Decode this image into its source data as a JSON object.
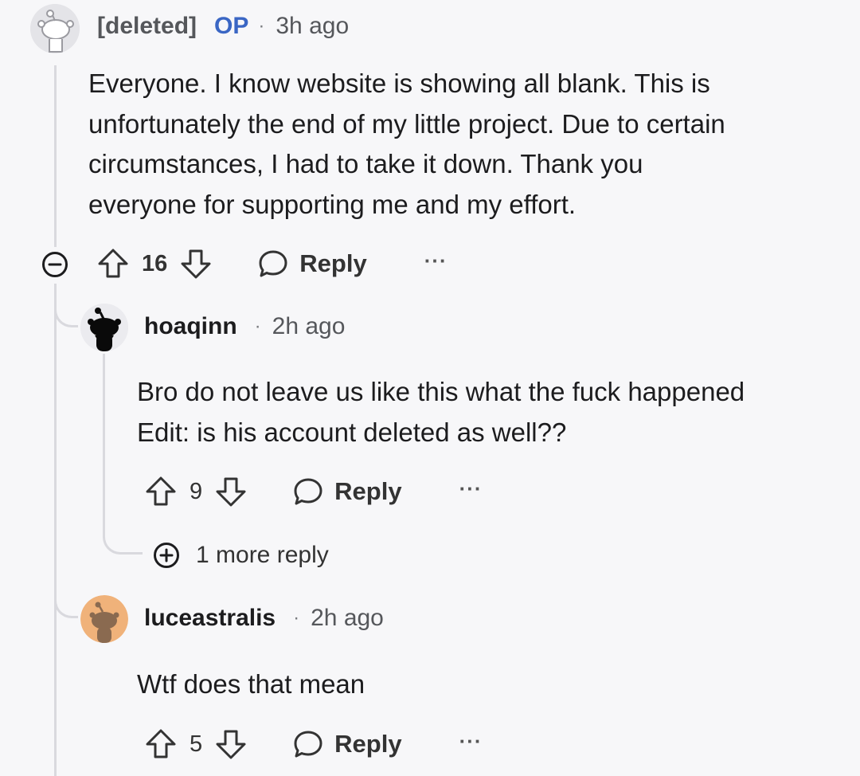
{
  "comments": [
    {
      "author": "[deleted]",
      "op_badge": "OP",
      "separator": "·",
      "time": "3h ago",
      "body_lines": [
        "Everyone. I know website is showing all blank. This is",
        "unfortunately the end of my little project. Due to certain",
        "circumstances, I had to take it down. Thank you",
        "everyone for supporting me and my effort."
      ],
      "votes": "16",
      "reply_label": "Reply",
      "more_label": "···"
    },
    {
      "author": "hoaqinn",
      "separator": "·",
      "time": "2h ago",
      "body_lines": [
        "Bro do not leave us like this what the fuck happened",
        "Edit: is his account deleted as well??"
      ],
      "votes": "9",
      "reply_label": "Reply",
      "more_label": "···",
      "more_replies_label": "1 more reply"
    },
    {
      "author": "luceastralis",
      "separator": "·",
      "time": "2h ago",
      "body_lines": [
        "Wtf does that mean"
      ],
      "votes": "5",
      "reply_label": "Reply",
      "more_label": "···"
    }
  ],
  "colors": {
    "background": "#f7f7f9",
    "op_badge": "#3a66c4",
    "thread_line": "#d9d9de",
    "avatar_orange": "#f0b27a"
  },
  "icons": [
    "snoo-avatar-icon",
    "collapse-icon",
    "upvote-icon",
    "downvote-icon",
    "reply-bubble-icon",
    "more-options-icon",
    "expand-plus-icon"
  ]
}
